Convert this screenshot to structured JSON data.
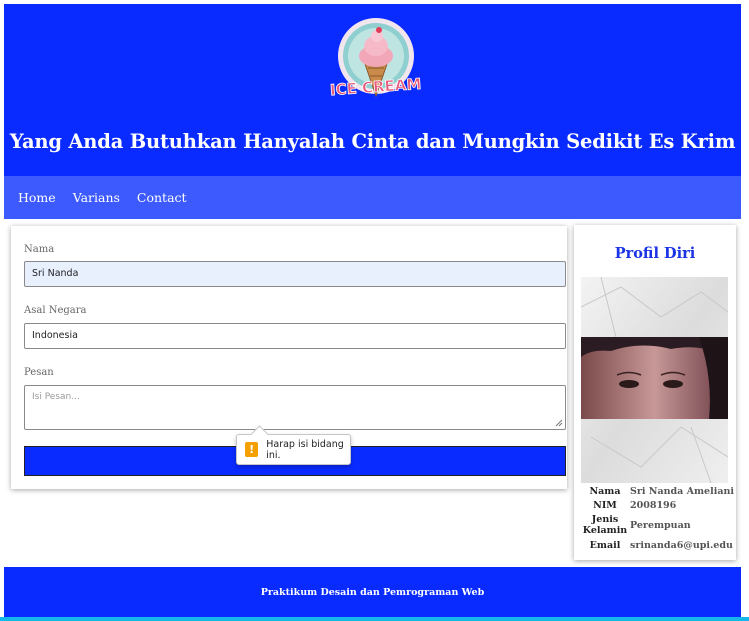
{
  "header": {
    "logo_text": "ICE CREAM",
    "title": "Yang Anda Butuhkan Hanyalah Cinta dan Mungkin Sedikit Es Krim",
    "bg_color": "#0a2bff"
  },
  "nav": {
    "items": [
      {
        "label": "Home"
      },
      {
        "label": "Varians"
      },
      {
        "label": "Contact"
      }
    ]
  },
  "form": {
    "nama_label": "Nama",
    "nama_value": "Sri Nanda",
    "negara_label": "Asal Negara",
    "negara_value": "Indonesia",
    "pesan_label": "Pesan",
    "pesan_placeholder": "Isi Pesan...",
    "submit_label": "",
    "validation_message": "Harap isi bidang ini."
  },
  "profile": {
    "title": "Profil Diri",
    "rows": [
      {
        "key": "Nama",
        "value": "Sri Nanda Ameliani"
      },
      {
        "key": "NIM",
        "value": "2008196"
      },
      {
        "key": "Jenis Kelamin",
        "value": "Perempuan"
      },
      {
        "key": "Email",
        "value": "srinanda6@upi.edu"
      }
    ]
  },
  "footer": {
    "text": "Praktikum Desain dan Pemrograman Web"
  },
  "colors": {
    "primary": "#0a2bff",
    "nav": "#3d5afe",
    "accent": "#1a33e6",
    "warning": "#f4a100"
  },
  "icons": {
    "warning": "warning-icon",
    "logo": "ice-cream-logo"
  }
}
